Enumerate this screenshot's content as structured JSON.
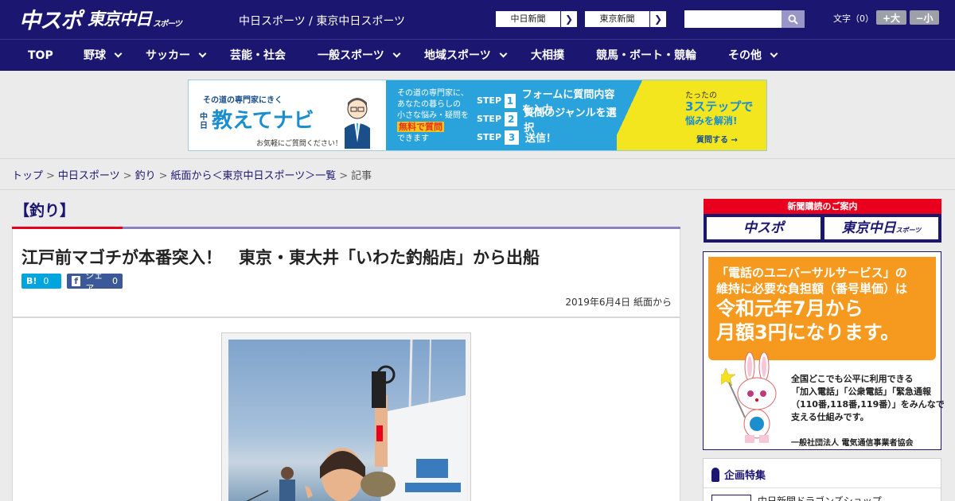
{
  "header": {
    "logo_chuspo": "中スポ",
    "logo_tokyo": "東京中日",
    "logo_tokyo_small": "スポーツ",
    "site_links": "中日スポーツ / 東京中日スポーツ",
    "chunichi_btn": "中日新聞",
    "tokyo_btn": "東京新聞",
    "font_size_label": "文字（0）",
    "font_up": "+大",
    "font_down": "−小"
  },
  "nav": [
    {
      "label": "TOP",
      "has_dropdown": false
    },
    {
      "label": "野球",
      "has_dropdown": true
    },
    {
      "label": "サッカー",
      "has_dropdown": true
    },
    {
      "label": "芸能・社会",
      "has_dropdown": false
    },
    {
      "label": "一般スポーツ",
      "has_dropdown": true
    },
    {
      "label": "地域スポーツ",
      "has_dropdown": true
    },
    {
      "label": "大相撲",
      "has_dropdown": false
    },
    {
      "label": "競馬・ボート・競輪",
      "has_dropdown": false
    },
    {
      "label": "その他",
      "has_dropdown": true
    }
  ],
  "banner_ad": {
    "top": "その道の専門家にきく",
    "mini": "中日",
    "brand": "教えてナビ",
    "sub": "お気軽にご質問ください！",
    "desc1": "その道の専門家に、",
    "desc2": "あなたの暮らしの",
    "desc3": "小さな悩み・疑問を",
    "desc4": "無料で質問",
    "desc5": "できます",
    "step_label": "STEP",
    "step1": "フォームに質問内容を入力",
    "step2": "質問のジャンルを選択",
    "step3": "送信！",
    "r1": "たったの",
    "r2": "3ステップで",
    "r3": "悩みを解消!",
    "r4": "質問する →"
  },
  "breadcrumb": [
    "トップ",
    "中日スポーツ",
    "釣り",
    "紙面から＜東京中日スポーツ＞一覧",
    "記事"
  ],
  "article": {
    "category": "【釣り】",
    "headline": "江戸前マゴチが本番突入！　東京・東大井「いわた釣船店」から出船",
    "hatena_label": "B!",
    "hatena_count": "0",
    "fb_label": "シェア",
    "fb_count": "0",
    "date": "2019年6月4日 紙面から"
  },
  "sidebar": {
    "subscribe_head": "新聞購読のご案内",
    "sub_chuspo": "中スポ",
    "sub_tokyo": "東京中日",
    "sub_tokyo_small": "スポーツ",
    "univ_l1": "「電話のユニバーサルサービス」の",
    "univ_l2": "維持に必要な負担額（番号単価）は",
    "univ_l3": "令和元年7月から",
    "univ_l4": "月額3円になります。",
    "univ_t1": "全国どこでも公平に利用できる",
    "univ_t2": "「加入電話」「公衆電話」「緊急通報",
    "univ_t3": "（110番,118番,119番）」をみんなで",
    "univ_t4": "支える仕組みです。",
    "univ_org": "一般社団法人 電気通信事業者協会",
    "special_title": "企画特集",
    "special_item": "中日新聞ドラゴンズショップ"
  },
  "colors": {
    "brand_navy": "#1b1670",
    "accent_red": "#e8001c",
    "accent_purple": "#8d80bf"
  }
}
